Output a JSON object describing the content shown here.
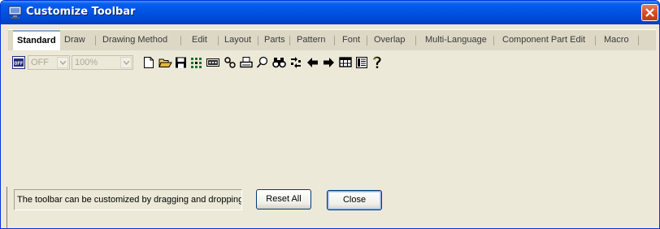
{
  "window": {
    "title": "Customize Toolbar"
  },
  "tabs": [
    {
      "label": "Standard",
      "active": true
    },
    {
      "label": "Draw"
    },
    {
      "label": "Drawing Method"
    },
    {
      "label": "Edit"
    },
    {
      "label": "Layout"
    },
    {
      "label": "Parts"
    },
    {
      "label": "Pattern"
    },
    {
      "label": "Font"
    },
    {
      "label": "Overlap"
    },
    {
      "label": "Multi-Language"
    },
    {
      "label": "Component Part Edit"
    },
    {
      "label": "Macro"
    }
  ],
  "toolbar": {
    "off_combo": "OFF",
    "off_icon_text": "OFF",
    "zoom_combo": "100%",
    "icons": [
      "new-document-icon",
      "open-folder-icon",
      "save-disk-icon",
      "grid-dots-icon",
      "sim-icon",
      "printer-setup-icon",
      "print-icon",
      "zoom-glass-icon",
      "binoculars-icon",
      "shuffle-arrows-icon",
      "arrow-left-icon",
      "arrow-right-icon",
      "table-icon",
      "list-icon",
      "help-icon"
    ]
  },
  "footer": {
    "hint": "The toolbar can be customized by dragging and dropping.",
    "reset_label": "Reset All",
    "close_label": "Close"
  },
  "colors": {
    "title_bar": "#0054e3",
    "face": "#ece9d8",
    "close": "#d44a26"
  }
}
